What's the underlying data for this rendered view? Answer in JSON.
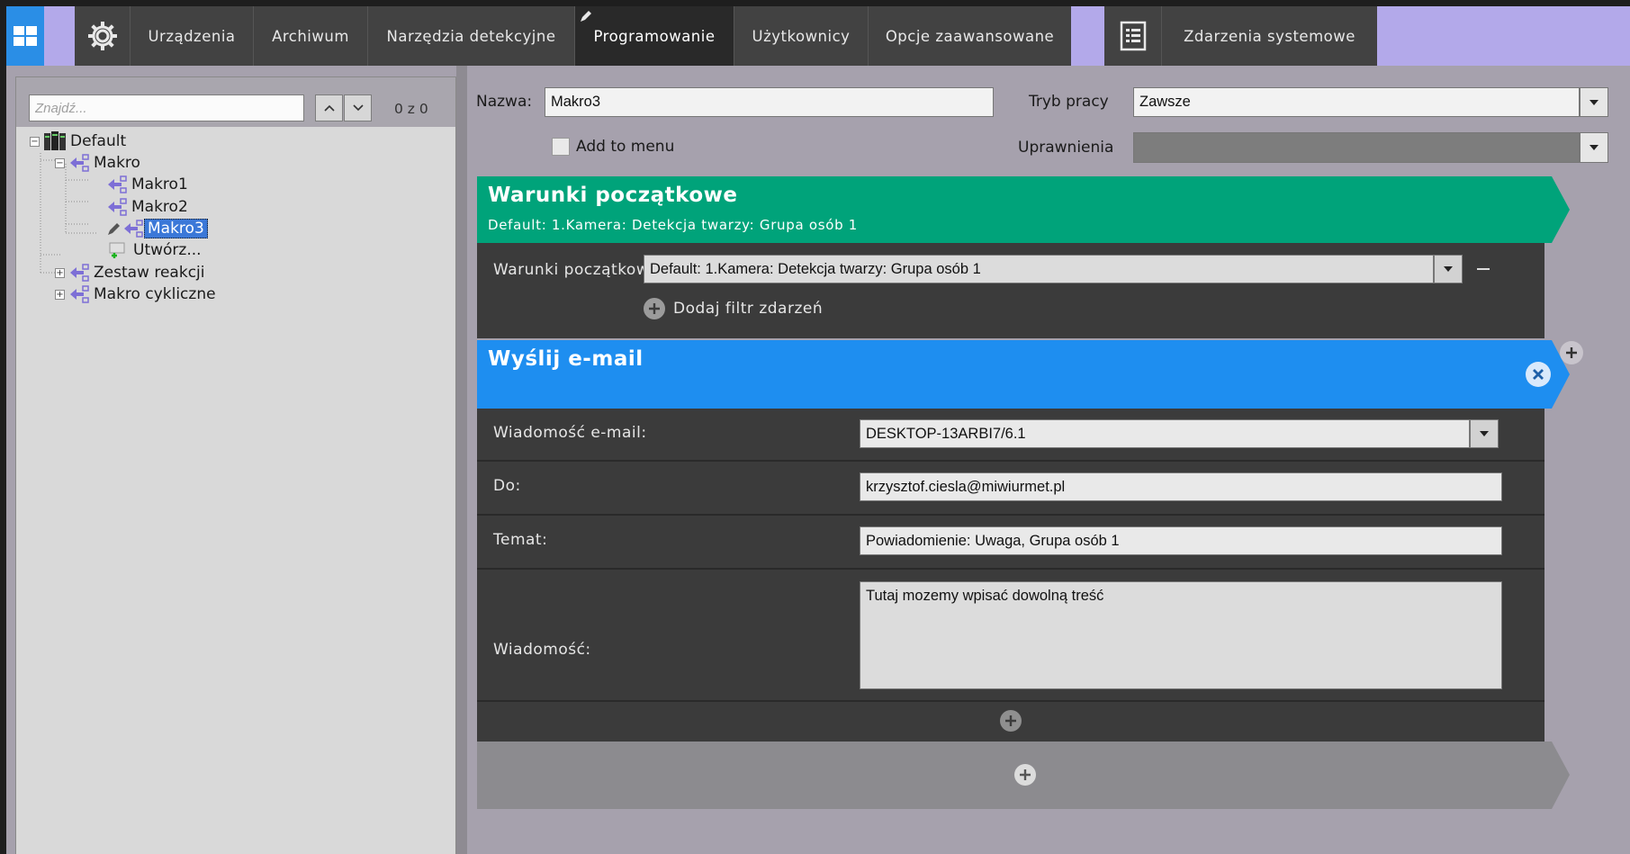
{
  "toolbar": {
    "tabs": [
      {
        "label": "Urządzenia"
      },
      {
        "label": "Archiwum"
      },
      {
        "label": "Narzędzia detekcyjne"
      },
      {
        "label": "Programowanie"
      },
      {
        "label": "Użytkownicy"
      },
      {
        "label": "Opcje zaawansowane"
      }
    ],
    "events_label": "Zdarzenia systemowe",
    "active_tab": "Programowanie"
  },
  "left": {
    "search_placeholder": "Znajdź...",
    "count": "0 z 0",
    "tree": {
      "root": "Default",
      "makro": "Makro",
      "makro1": "Makro1",
      "makro2": "Makro2",
      "makro3": "Makro3",
      "create": "Utwórz...",
      "reaction_set": "Zestaw reakcji",
      "cyclic": "Makro cykliczne"
    }
  },
  "form": {
    "name_label": "Nazwa:",
    "name_value": "Makro3",
    "mode_label": "Tryb pracy",
    "mode_value": "Zawsze",
    "add_to_menu": "Add to menu",
    "permissions_label": "Uprawnienia",
    "permissions_value": ""
  },
  "conditions": {
    "title": "Warunki początkowe",
    "subtitle": "Default: 1.Kamera: Detekcja twarzy: Grupa osób 1",
    "row_label": "Warunki początkowe",
    "row_value": "Default: 1.Kamera: Detekcja twarzy: Grupa osób 1",
    "add_filter": "Dodaj filtr zdarzeń",
    "color": "#00a37a"
  },
  "email": {
    "title": "Wyślij e-mail",
    "color": "#1e8ef0",
    "message_label": "Wiadomość e-mail:",
    "message_value": "DESKTOP-13ARBI7/6.1",
    "to_label": "Do:",
    "to_value": "krzysztof.ciesla@miwiurmet.pl",
    "subject_label": "Temat:",
    "subject_value": "Powiadomienie: Uwaga, Grupa osób 1",
    "body_label": "Wiadomość:",
    "body_value": "Tutaj mozemy wpisać dowolną treść"
  },
  "icons": [
    "app-grid-icon",
    "gear-icon",
    "pencil-icon",
    "event-log-icon",
    "tree-server-icon",
    "macro-icon",
    "add-icon",
    "close-icon",
    "chevron-down-icon",
    "chevron-up-icon"
  ]
}
